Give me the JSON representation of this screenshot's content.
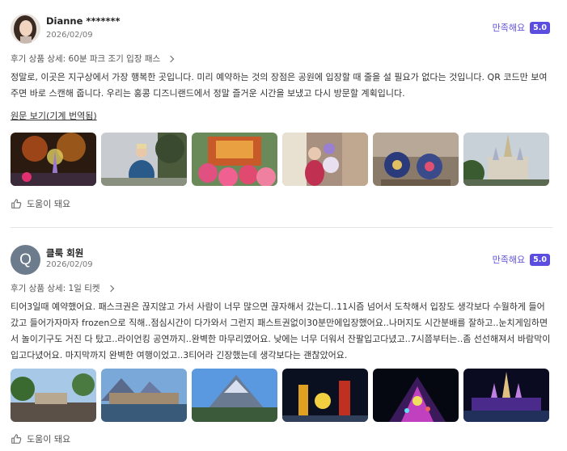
{
  "reviews": [
    {
      "name": "Dianne *******",
      "date": "2026/02/09",
      "rating_label": "만족해요",
      "rating_value": "5.0",
      "product": "후기 상품 상세: 60분 파크 조기 입장 패스",
      "text": "정말로, 이곳은 지구상에서 가장 행복한 곳입니다. 미리 예약하는 것의 장점은 공원에 입장할 때 줄을 설 필요가 없다는 것입니다. QR 코드만 보여주면 바로 스캔해 줍니다. 우리는 홍콩 디즈니랜드에서 정말 즐거운 시간을 보냈고 다시 방문할 계획입니다.",
      "translate_link": "원문 보기(기계 번역됨)",
      "helpful": "도움이 돼요"
    },
    {
      "name": "클룩 회원",
      "avatar_initial": "Q",
      "date": "2026/02/09",
      "rating_label": "만족해요",
      "rating_value": "5.0",
      "product": "후기 상품 상세: 1일 티켓",
      "text": "티어3일때 예약했어요. 패스크권은 끊지않고 가서 사람이 너무 많으면 끊자해서 갔는디..11시즘 넘어서 도착해서 입장도 생각보다 수월하게 들어갔고 들어가자마자 frozen으로 직해..점심시간이 다가와서 그런지 패스트권없이30분만에입장했어요..나머지도 시간분배를 잘하고..눈치게임하면서 놀이기구도 거진 다 탔고..라이언킹 공연까지..완벽한 마무리였어요. 낮에는 너무 더워서 잔팔입고다녔고..7시쯤부터는..좀 선선해져서 바람막이입고다녔어요. 마지막까지 완벽한 여행이었고..3티어라 긴장했는데 생각보다는 괜찮았어요.",
      "helpful": "도움이 돼요"
    }
  ],
  "colors": {
    "accent": "#5b4de0",
    "text": "#333333"
  }
}
